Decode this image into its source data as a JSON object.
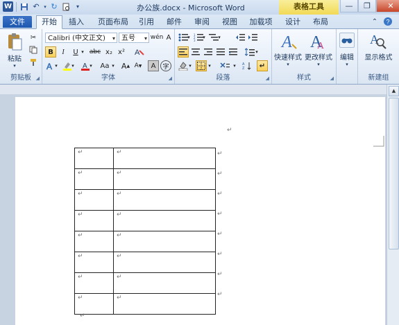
{
  "titlebar": {
    "doc_title": "办公族.docx - Microsoft Word",
    "context_tab": "表格工具",
    "app_icon": "W"
  },
  "tabs": [
    {
      "label": "文件"
    },
    {
      "label": "开始"
    },
    {
      "label": "插入"
    },
    {
      "label": "页面布局"
    },
    {
      "label": "引用"
    },
    {
      "label": "邮件"
    },
    {
      "label": "审阅"
    },
    {
      "label": "视图"
    },
    {
      "label": "加载项"
    },
    {
      "label": "设计"
    },
    {
      "label": "布局"
    }
  ],
  "ribbon": {
    "clipboard": {
      "group_label": "剪贴板",
      "paste_label": "粘贴"
    },
    "font": {
      "group_label": "字体",
      "font_name": "Calibri (中文正文)",
      "font_size": "五号",
      "bold": "B",
      "italic": "I",
      "underline": "U",
      "strike": "abc",
      "sub": "x₂",
      "sup": "x²",
      "grow": "A",
      "shrink": "A",
      "case": "Aa",
      "clear": "A",
      "phonetic": "wén",
      "border_char": "A",
      "enclose": "字"
    },
    "paragraph": {
      "group_label": "段落"
    },
    "styles": {
      "group_label": "样式",
      "quick_styles": "快速样式",
      "change_styles": "更改样式"
    },
    "editing": {
      "group_label": "",
      "edit_label": "编辑"
    },
    "newgroup": {
      "group_label": "新建组",
      "show_format": "显示格式"
    }
  },
  "document": {
    "heading_mark": "↵",
    "table": {
      "rows": 8,
      "cells": [
        [
          "↵",
          "↵"
        ],
        [
          "↵",
          "↵"
        ],
        [
          "↵",
          "↵"
        ],
        [
          "↵",
          "↵"
        ],
        [
          "↵",
          "↵"
        ],
        [
          "↵",
          "↵"
        ],
        [
          "↵",
          "↵"
        ],
        [
          "↵",
          "↵"
        ]
      ],
      "row_end_mark": "↵"
    },
    "after_table_mark": "↵"
  },
  "colors": {
    "file_tab": "#1d58b0",
    "context_tab": "#f1d955",
    "close_button": "#c8462a",
    "highlight_yellow": "#ffff00",
    "font_red": "#e02020"
  }
}
